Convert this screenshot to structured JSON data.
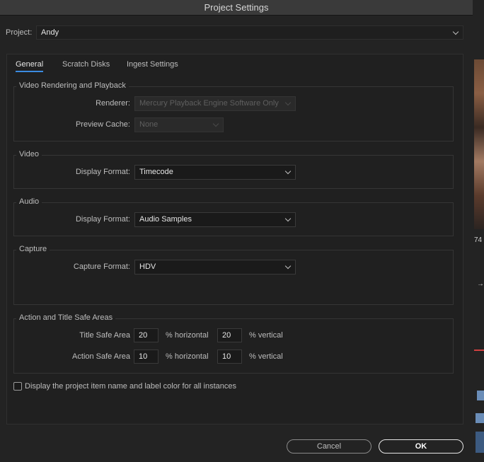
{
  "dialog": {
    "title": "Project Settings"
  },
  "project": {
    "label": "Project:",
    "value": "Andy"
  },
  "tabs": [
    {
      "label": "General",
      "active": true
    },
    {
      "label": "Scratch Disks",
      "active": false
    },
    {
      "label": "Ingest Settings",
      "active": false
    }
  ],
  "rendering": {
    "title": "Video Rendering and Playback",
    "renderer_label": "Renderer:",
    "renderer_value": "Mercury Playback Engine Software Only",
    "preview_cache_label": "Preview Cache:",
    "preview_cache_value": "None"
  },
  "video": {
    "title": "Video",
    "display_format_label": "Display Format:",
    "display_format_value": "Timecode"
  },
  "audio": {
    "title": "Audio",
    "display_format_label": "Display Format:",
    "display_format_value": "Audio Samples"
  },
  "capture": {
    "title": "Capture",
    "capture_format_label": "Capture Format:",
    "capture_format_value": "HDV"
  },
  "safe_areas": {
    "title": "Action and Title Safe Areas",
    "title_safe_label": "Title Safe Area",
    "title_safe_h": "20",
    "title_safe_v": "20",
    "action_safe_label": "Action Safe Area",
    "action_safe_h": "10",
    "action_safe_v": "10",
    "horizontal_label": "% horizontal",
    "vertical_label": "% vertical"
  },
  "checkbox": {
    "label": "Display the project item name and label color for all instances",
    "checked": false
  },
  "buttons": {
    "cancel": "Cancel",
    "ok": "OK"
  },
  "background_app": {
    "partial_text": "74"
  },
  "colors": {
    "accent": "#3b8be0",
    "dialog_bg": "#232323",
    "titlebar_bg": "#3a3a3a"
  }
}
